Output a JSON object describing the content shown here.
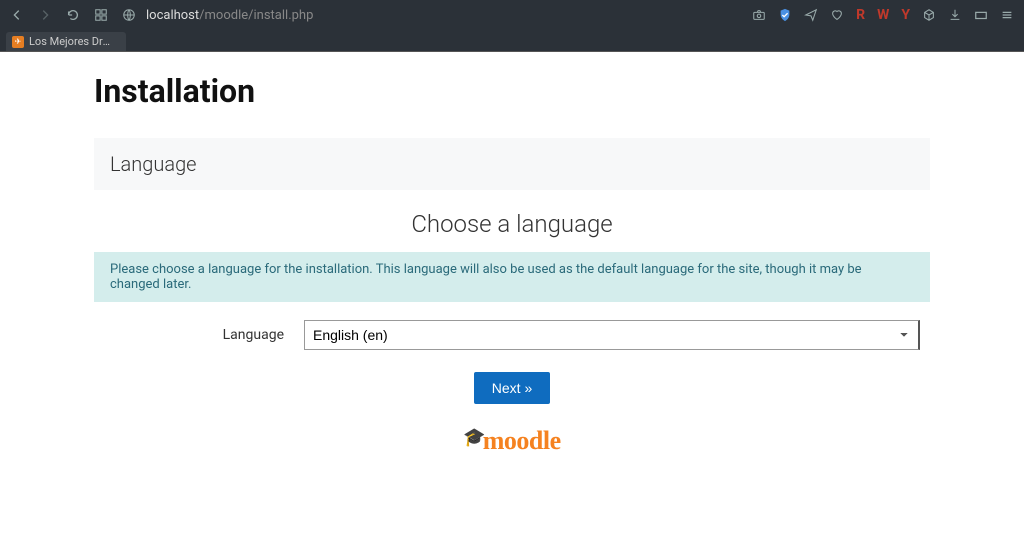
{
  "browser": {
    "url_domain": "localhost",
    "url_path": "/moodle/install.php",
    "tab_label": "Los Mejores Dro..."
  },
  "page": {
    "title": "Installation",
    "section_header": "Language",
    "subtitle": "Choose a language",
    "info_text": "Please choose a language for the installation. This language will also be used as the default language for the site, though it may be changed later.",
    "form": {
      "language_label": "Language",
      "language_value": "English (en)"
    },
    "next_button": "Next »",
    "logo_text": "moodle"
  }
}
